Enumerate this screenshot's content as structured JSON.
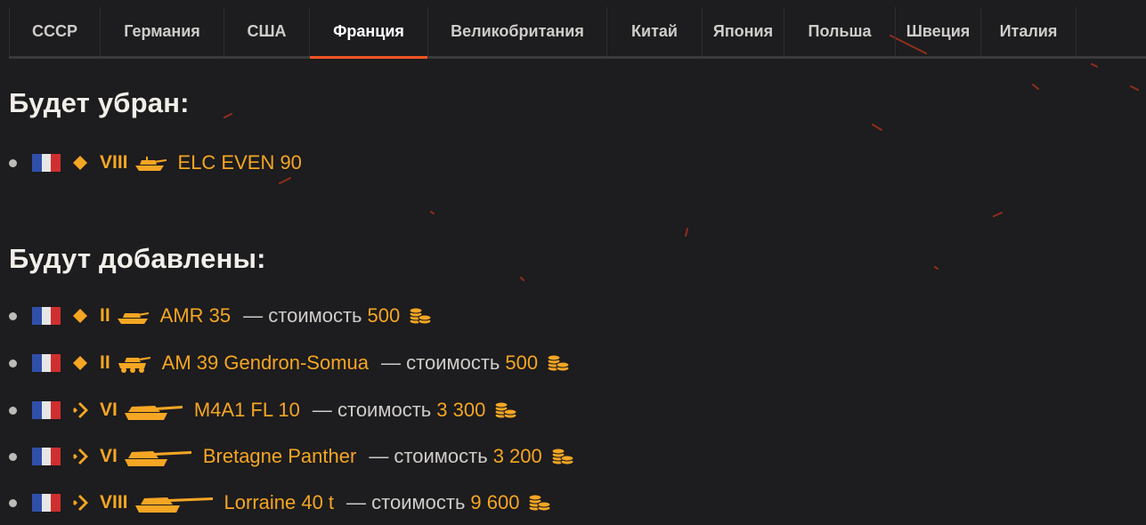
{
  "tabs": [
    {
      "label": "СССР",
      "active": false
    },
    {
      "label": "Германия",
      "active": false
    },
    {
      "label": "США",
      "active": false
    },
    {
      "label": "Франция",
      "active": true
    },
    {
      "label": "Великобритания",
      "active": false
    },
    {
      "label": "Китай",
      "active": false
    },
    {
      "label": "Япония",
      "active": false
    },
    {
      "label": "Польша",
      "active": false
    },
    {
      "label": "Швеция",
      "active": false
    },
    {
      "label": "Италия",
      "active": false
    }
  ],
  "colors": {
    "accent": "#f25322",
    "gold": "#f5a623",
    "background": "#1d1c1e"
  },
  "removed": {
    "heading": "Будет убран:",
    "items": [
      {
        "flag_icon": "france-flag-icon",
        "type_icon": "light-tank-diamond-icon",
        "tier": "VIII",
        "tank_icon": "tank-silhouette-icon",
        "name": "ELC EVEN 90"
      }
    ]
  },
  "added": {
    "heading": "Будут добавлены:",
    "cost_label": "— стоимость",
    "coin_icon": "gold-coins-icon",
    "items": [
      {
        "flag_icon": "france-flag-icon",
        "type_icon": "light-tank-diamond-icon",
        "tier": "II",
        "name": "AMR 35",
        "cost": "500"
      },
      {
        "flag_icon": "france-flag-icon",
        "type_icon": "light-tank-diamond-icon",
        "tier": "II",
        "name": "AM 39 Gendron-Somua",
        "cost": "500"
      },
      {
        "flag_icon": "france-flag-icon",
        "type_icon": "medium-tank-chevron-icon",
        "tier": "VI",
        "name": "M4A1 FL 10",
        "cost": "3 300"
      },
      {
        "flag_icon": "france-flag-icon",
        "type_icon": "medium-tank-chevron-icon",
        "tier": "VI",
        "name": "Bretagne Panther",
        "cost": "3 200"
      },
      {
        "flag_icon": "france-flag-icon",
        "type_icon": "medium-tank-chevron-icon",
        "tier": "VIII",
        "name": "Lorraine 40 t",
        "cost": "9 600"
      }
    ]
  }
}
